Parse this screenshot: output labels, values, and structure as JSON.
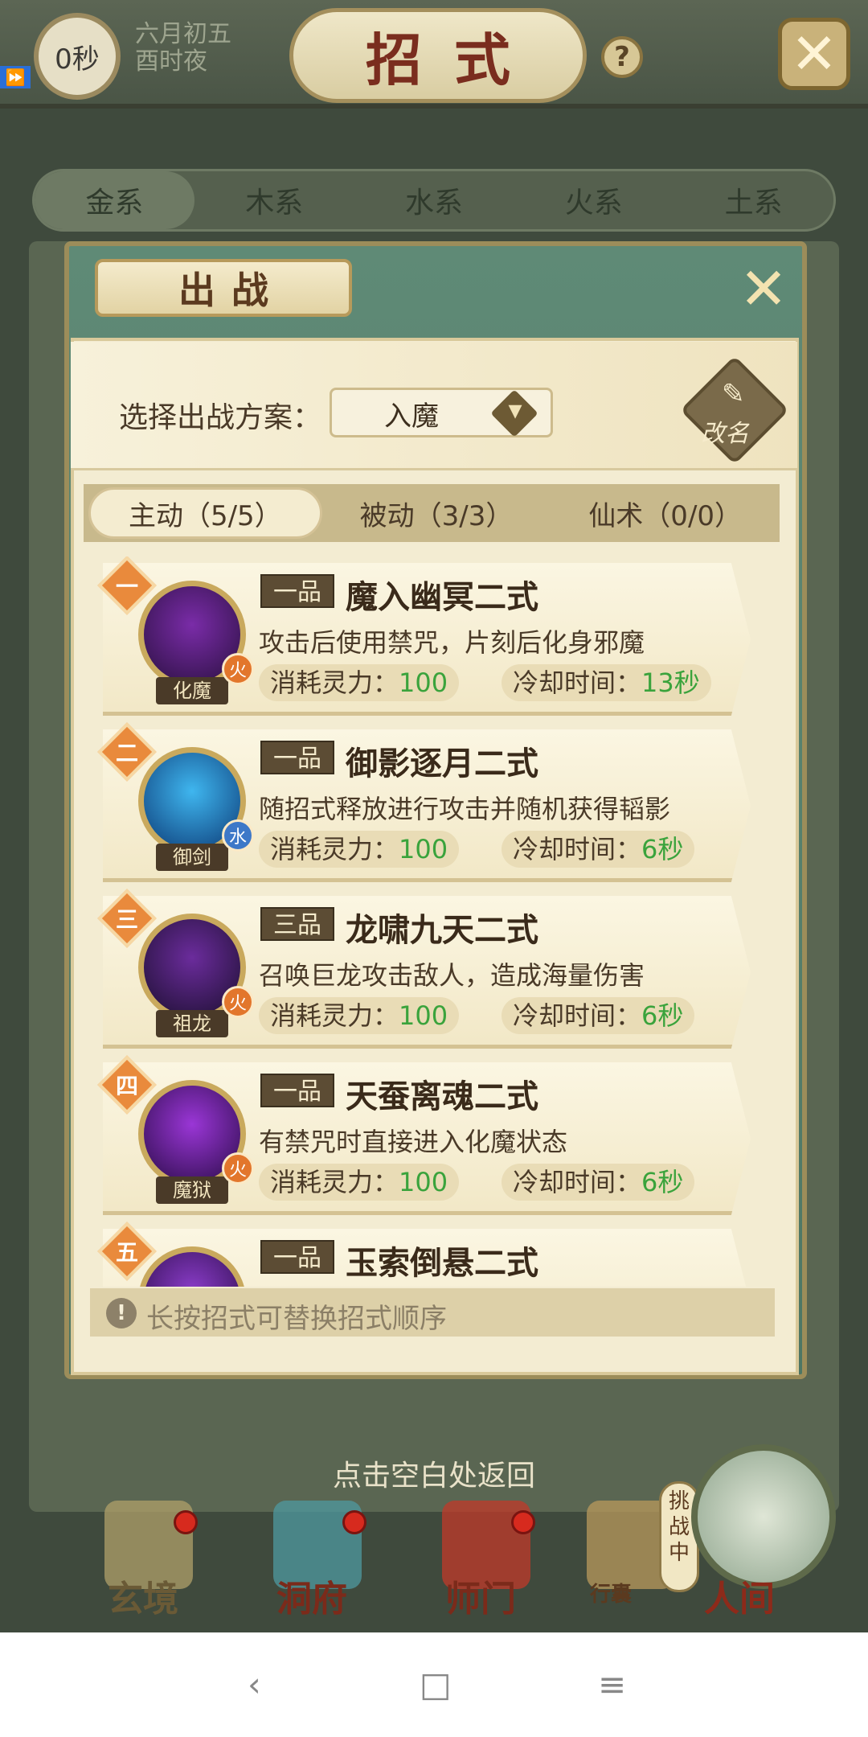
{
  "topbar": {
    "timer": "0秒",
    "date_line1": "六月初五",
    "date_line2": "酉时夜",
    "title": "招式",
    "help_icon": "?"
  },
  "element_tabs": [
    "金系",
    "木系",
    "水系",
    "火系",
    "土系"
  ],
  "modal": {
    "title": "出战",
    "plan_label": "选择出战方案：",
    "plan_value": "入魔",
    "rename_label": "改名",
    "skill_tabs": [
      "主动（5/5）",
      "被动（3/3）",
      "仙术（0/0）"
    ],
    "skills": [
      {
        "rank": "一",
        "avatar_name": "化魔",
        "element": "火",
        "grade": "一品",
        "name": "魔入幽冥二式",
        "desc": "攻击后使用禁咒，片刻后化身邪魔",
        "cost_label": "消耗灵力：",
        "cost": "100",
        "cd_label": "冷却时间：",
        "cd": "13秒",
        "colors": [
          "#7a2ca8",
          "#2a1040"
        ],
        "elem_color": "#e2762c"
      },
      {
        "rank": "二",
        "avatar_name": "御剑",
        "element": "水",
        "grade": "一品",
        "name": "御影逐月二式",
        "desc": "随招式释放进行攻击并随机获得韬影",
        "cost_label": "消耗灵力：",
        "cost": "100",
        "cd_label": "冷却时间：",
        "cd": "6秒",
        "colors": [
          "#3fb6ef",
          "#0c3a76"
        ],
        "elem_color": "#3d78c8"
      },
      {
        "rank": "三",
        "avatar_name": "祖龙",
        "element": "火",
        "grade": "三品",
        "name": "龙啸九天二式",
        "desc": "召唤巨龙攻击敌人，造成海量伤害",
        "cost_label": "消耗灵力：",
        "cost": "100",
        "cd_label": "冷却时间：",
        "cd": "6秒",
        "colors": [
          "#6b2c9c",
          "#1c0f30"
        ],
        "elem_color": "#e2762c"
      },
      {
        "rank": "四",
        "avatar_name": "魔狱",
        "element": "火",
        "grade": "一品",
        "name": "天蚕离魂二式",
        "desc": "有禁咒时直接进入化魔状态",
        "cost_label": "消耗灵力：",
        "cost": "100",
        "cd_label": "冷却时间：",
        "cd": "6秒",
        "colors": [
          "#9a36d6",
          "#2a0c48"
        ],
        "elem_color": "#e2762c"
      },
      {
        "rank": "五",
        "avatar_name": "",
        "element": "",
        "grade": "一品",
        "name": "玉索倒悬二式",
        "desc": "",
        "cost_label": "",
        "cost": "",
        "cd_label": "",
        "cd": "",
        "colors": [
          "#8a3cc8",
          "#2a0c48"
        ],
        "elem_color": "#e2762c"
      }
    ],
    "hint": "长按招式可替换招式顺序"
  },
  "back_hint": "点击空白处返回",
  "bottom_nav": [
    {
      "label": "玄境",
      "dot": true
    },
    {
      "label": "洞府",
      "dot": true
    },
    {
      "label": "师门",
      "dot": true
    },
    {
      "label": "行囊",
      "dot": false
    }
  ],
  "challenge": "挑战中",
  "world_label": "人间",
  "android": {
    "back": "‹",
    "home": "□",
    "menu": "≡"
  }
}
